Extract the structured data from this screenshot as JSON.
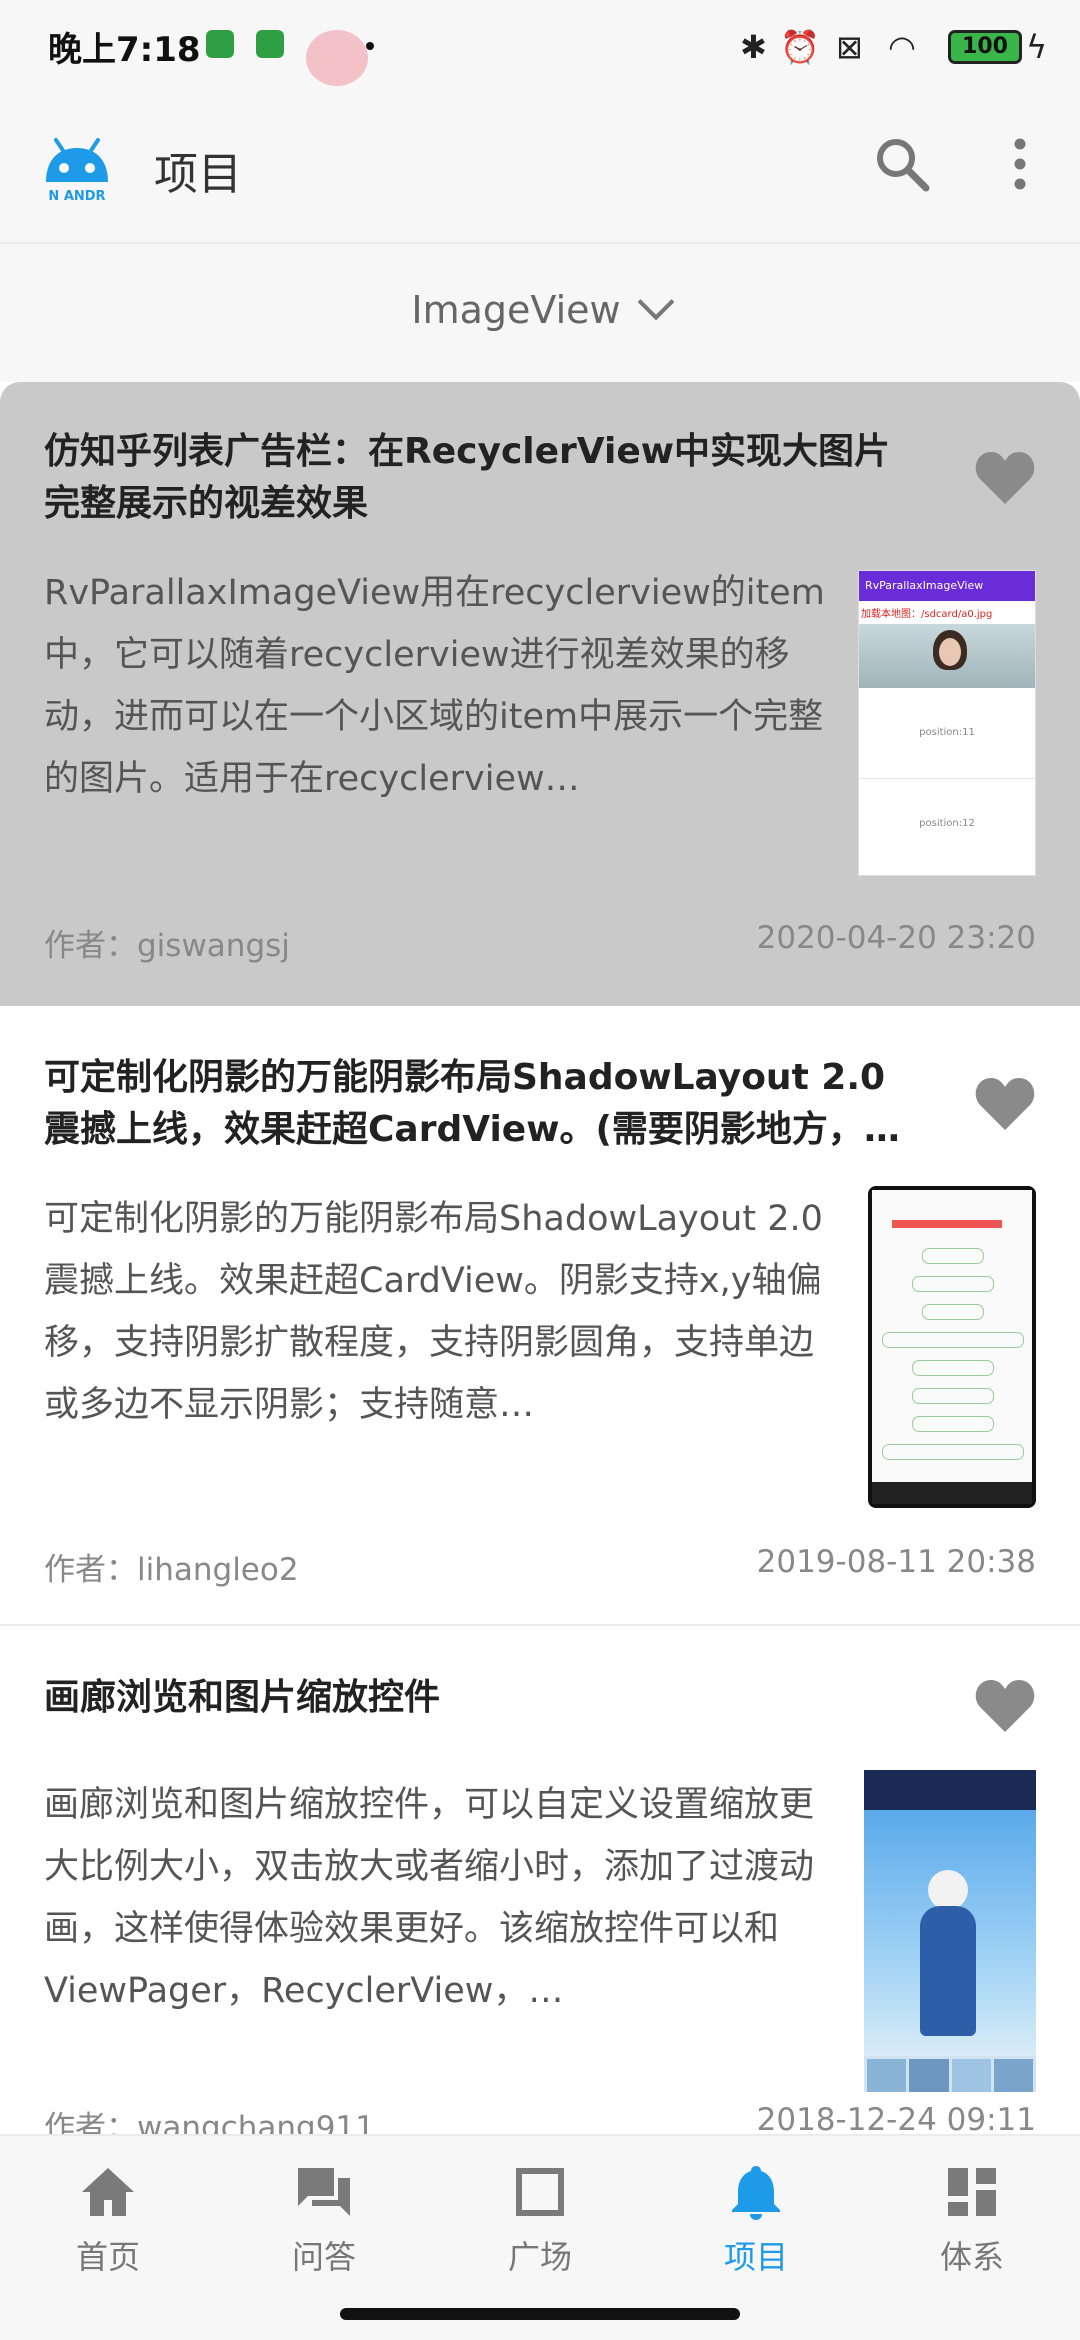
{
  "status_bar": {
    "time": "晚上7:18",
    "battery": "100",
    "icons": [
      "bluetooth-icon",
      "alarm-icon",
      "sim-icon",
      "wifi-icon",
      "battery-icon",
      "charging-icon"
    ]
  },
  "app_bar": {
    "title": "项目",
    "logo_icon": "android-logo",
    "search_icon": "search-icon",
    "more_icon": "more-vertical-icon"
  },
  "filter": {
    "label": "ImageView",
    "icon": "chevron-down-icon"
  },
  "articles": [
    {
      "title": "仿知乎列表广告栏：在RecyclerView中实现大图片完整展示的视差效果",
      "description": "RvParallaxImageView用在recyclerview的item中，它可以随着recyclerview进行视差效果的移动，进而可以在一个小区域的item中展示一个完整的图片。适用于在recyclerview…",
      "author": "作者：giswangsj",
      "date": "2020-04-20 23:20",
      "thumb": {
        "header": "RvParallaxImageView",
        "path": "加载本地图：/sdcard/a0.jpg",
        "row1": "position:11",
        "row2": "position:12"
      }
    },
    {
      "title": "可定制化阴影的万能阴影布局ShadowLayout 2.0 震撼上线，效果赶超CardView。(需要阴影地方，…",
      "description": "可定制化阴影的万能阴影布局ShadowLayout 2.0 震撼上线。效果赶超CardView。阴影支持x,y轴偏移，支持阴影扩散程度，支持阴影圆角，支持单边或多边不显示阴影；支持随意…",
      "author": "作者：lihangleo2",
      "date": "2019-08-11 20:38"
    },
    {
      "title": "画廊浏览和图片缩放控件",
      "description": "画廊浏览和图片缩放控件，可以自定义设置缩放更大比例大小，双击放大或者缩小时，添加了过渡动画，这样使得体验效果更好。该缩放控件可以和ViewPager，RecyclerView，…",
      "author": "作者：wangchang911",
      "date": "2018-12-24 09:11"
    }
  ],
  "bottom_nav": [
    {
      "label": "首页",
      "icon": "home-icon",
      "active": false
    },
    {
      "label": "问答",
      "icon": "forum-icon",
      "active": false
    },
    {
      "label": "广场",
      "icon": "square-icon",
      "active": false
    },
    {
      "label": "项目",
      "icon": "bell-icon",
      "active": true
    },
    {
      "label": "体系",
      "icon": "dashboard-icon",
      "active": false
    }
  ],
  "colors": {
    "accent": "#1e9be8",
    "selected_card": "#c9c9c9",
    "heart": "#8a8a8a"
  }
}
